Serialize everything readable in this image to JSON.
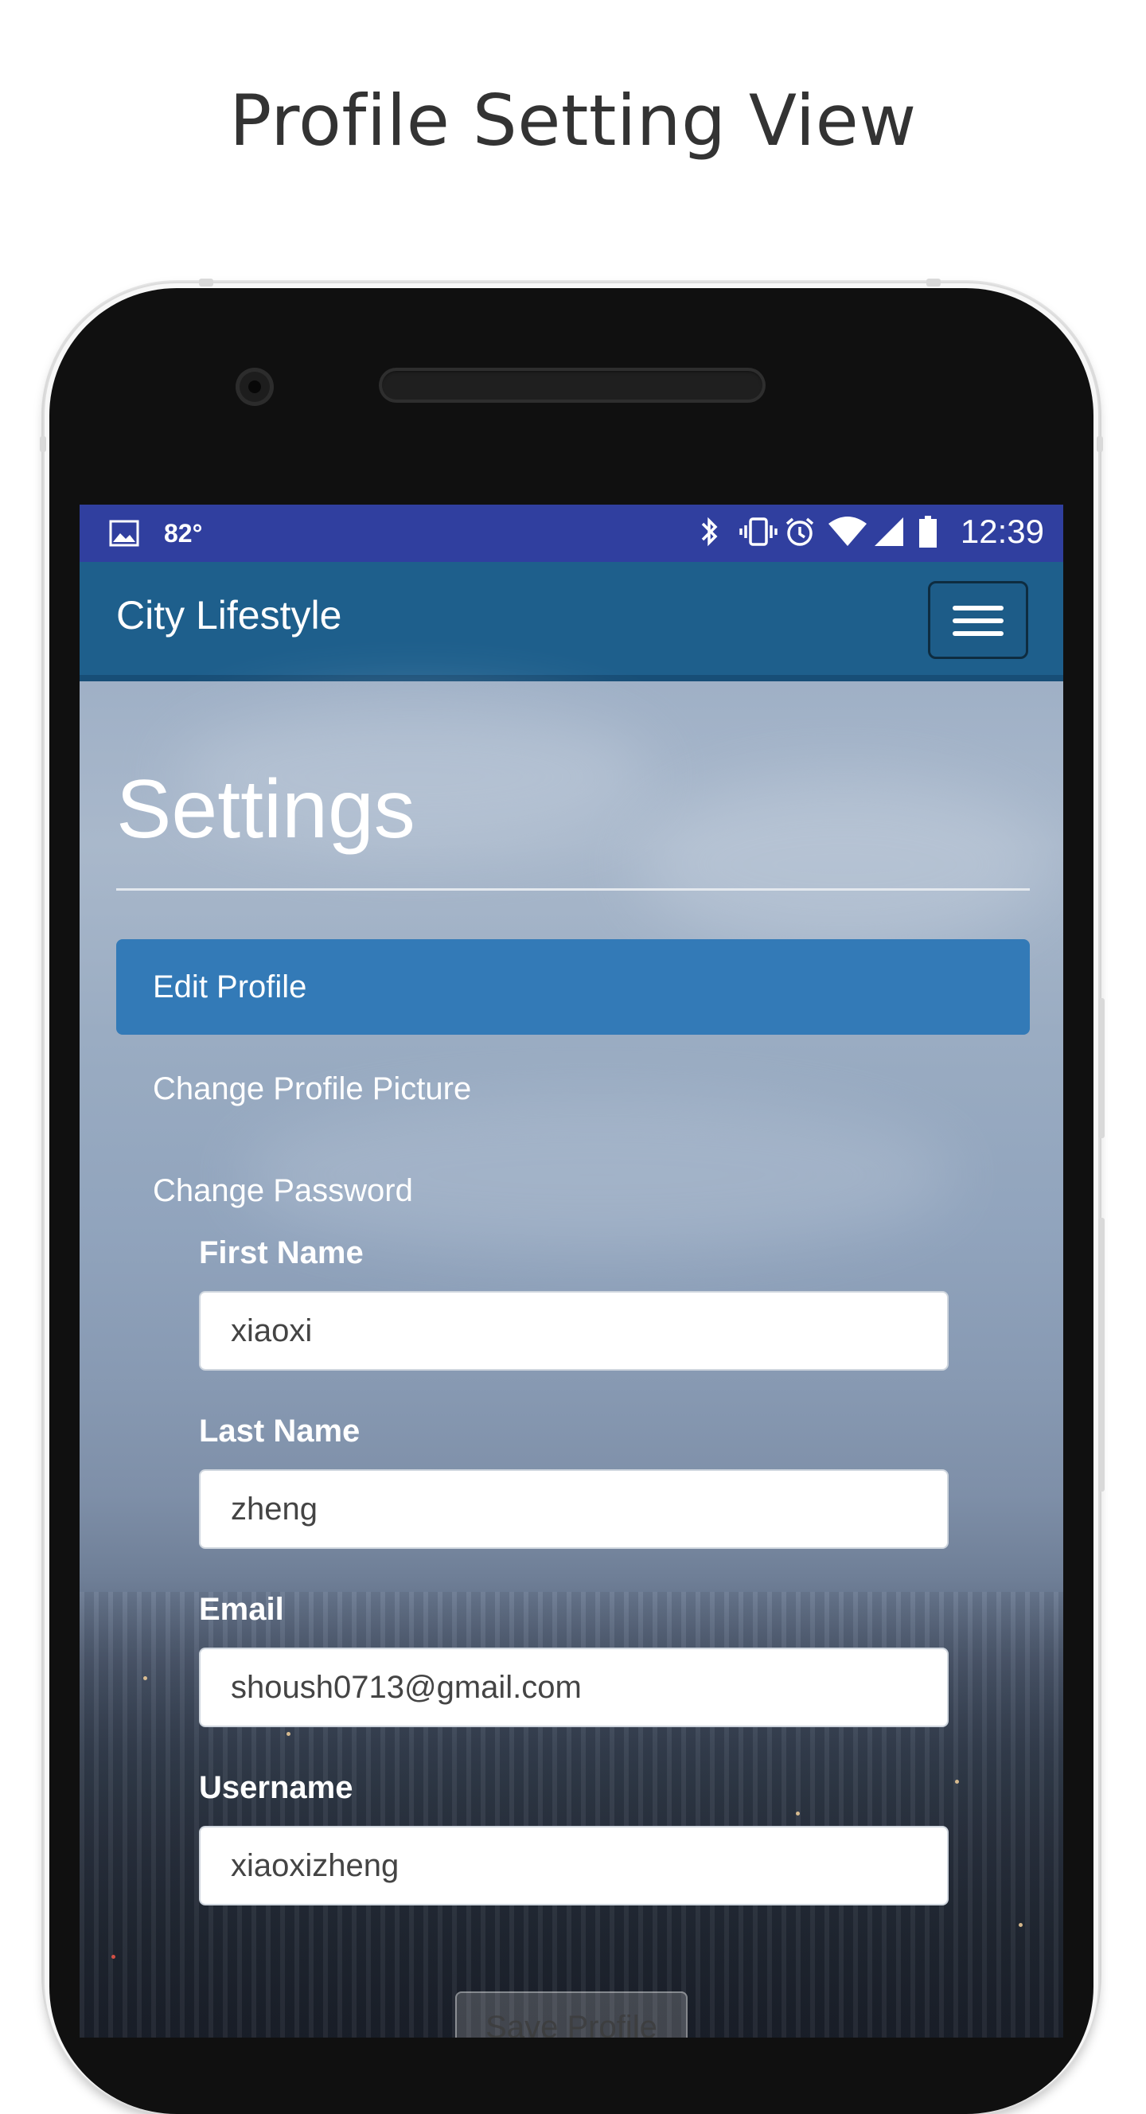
{
  "heading": "Profile Setting View",
  "status_bar": {
    "temperature": "82°",
    "time": "12:39",
    "icons": [
      "image-icon",
      "bluetooth-icon",
      "vibrate-icon",
      "alarm-icon",
      "wifi-icon",
      "signal-icon",
      "battery-icon"
    ]
  },
  "navbar": {
    "brand": "City Lifestyle",
    "menu_icon": "hamburger-menu-icon"
  },
  "page": {
    "title": "Settings",
    "menu": [
      {
        "label": "Edit Profile",
        "active": true
      },
      {
        "label": "Change Profile Picture",
        "active": false
      },
      {
        "label": "Change Password",
        "active": false
      }
    ]
  },
  "form": {
    "first_name": {
      "label": "First Name",
      "value": "xiaoxi"
    },
    "last_name": {
      "label": "Last Name",
      "value": "zheng"
    },
    "email": {
      "label": "Email",
      "value": "shoush0713@gmail.com"
    },
    "username": {
      "label": "Username",
      "value": "xiaoxizheng"
    },
    "save_label": "Save Profile"
  },
  "colors": {
    "status_bar": "#303f9f",
    "navbar": "#1e5f8c",
    "active_menu": "#337ab7"
  }
}
